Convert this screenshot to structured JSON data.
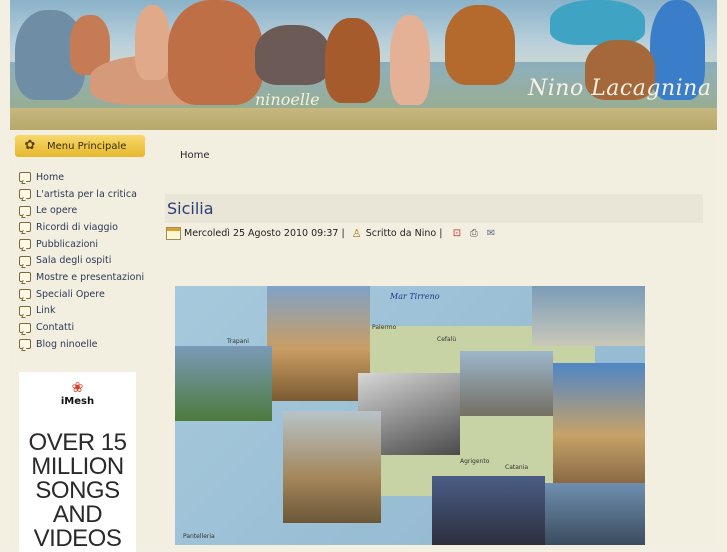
{
  "banner": {
    "site_name": "ninoelle",
    "author_name": "Nino Lacagnina"
  },
  "sidebar": {
    "menu_title": "Menu Principale",
    "items": [
      {
        "label": "Home"
      },
      {
        "label": "L'artista per la critica"
      },
      {
        "label": "Le opere"
      },
      {
        "label": "Ricordi di viaggio"
      },
      {
        "label": "Pubblicazioni"
      },
      {
        "label": "Sala degli ospiti"
      },
      {
        "label": "Mostre e presentazioni"
      },
      {
        "label": "Speciali Opere"
      },
      {
        "label": "Link"
      },
      {
        "label": "Contatti"
      },
      {
        "label": "Blog ninoelle"
      }
    ]
  },
  "ad": {
    "brand": "iMesh",
    "headline_lines": [
      "OVER 15",
      "MILLION",
      "SONGS",
      "AND",
      "VIDEOS"
    ]
  },
  "breadcrumb": "Home",
  "article": {
    "title": "Sicilia",
    "date": "Mercoledì 25 Agosto 2010 09:37",
    "author": "Scritto da Nino"
  },
  "collage": {
    "map_labels": [
      "Mar Tirreno",
      "Trapani",
      "Palermo",
      "Cefalù",
      "Catania",
      "Agrigento",
      "Pantelleria"
    ]
  },
  "colors": {
    "menu_accent": "#e5b72d",
    "title_text": "#2a3f7a",
    "strip": "#b6a76a"
  }
}
